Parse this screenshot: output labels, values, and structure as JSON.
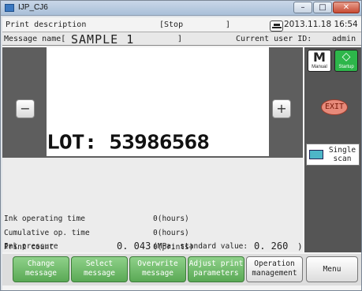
{
  "window": {
    "title": "IJP_CJ6",
    "min": "–",
    "max": "□",
    "close": "✕"
  },
  "status": {
    "description_label": "Print description",
    "state_open": "[Stop",
    "state_close": "]",
    "date": "2013.11.18 16:54",
    "control_icon": "Con-O"
  },
  "message": {
    "label": "Message name[",
    "name": "SAMPLE  1",
    "close": "]",
    "user_label": "Current user ID:",
    "user": "admin"
  },
  "editor": {
    "minus_label": "−",
    "plus_label": "+",
    "content": "LOT: 53986568"
  },
  "info": {
    "rows": [
      {
        "label": "Ink operating time",
        "value": "0(hours)"
      },
      {
        "label": "Cumulative op. time",
        "value": "0(hours)"
      },
      {
        "label": "Print count",
        "value": "0(prints)"
      }
    ],
    "pressure_label": "Ink pressure",
    "pressure_value": "0. 043",
    "pressure_mid": "(MPa; standard value:",
    "pressure_std": "0. 260",
    "pressure_end": ")"
  },
  "side": {
    "manual_glyph": "M",
    "manual_label": "Manual",
    "startup_glyph": "◇",
    "startup_label": "Startup",
    "exit_label": "EXIT",
    "scan_line1": "Single",
    "scan_line2": "scan"
  },
  "footer": {
    "change": [
      "Change",
      "message"
    ],
    "select": [
      "Select",
      "message"
    ],
    "overwrite": [
      "Overwrite",
      "message"
    ],
    "adjust": [
      "Adjust print",
      "parameters"
    ],
    "operation": [
      "Operation",
      "management"
    ],
    "menu": "Menu"
  },
  "colors": {
    "accent_green": "#5aa955",
    "exit_red": "#e78a7a",
    "panel_gray": "#5e5e5e"
  }
}
